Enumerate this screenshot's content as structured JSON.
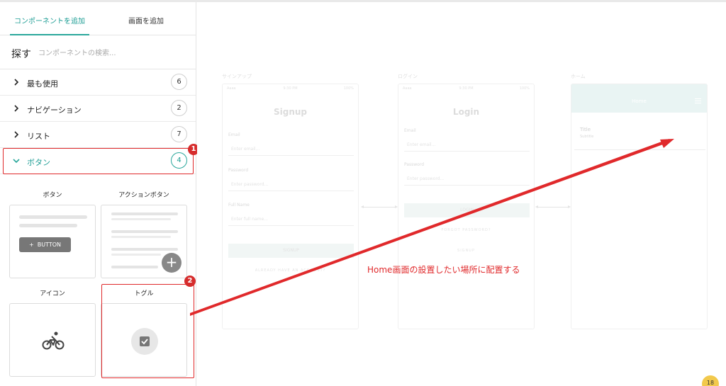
{
  "tabs": [
    {
      "label": "コンポーネントを追加"
    },
    {
      "label": "画面を追加"
    }
  ],
  "search": {
    "label": "探す",
    "placeholder": "コンポーネントの検索..."
  },
  "categories": [
    {
      "label": "最も使用",
      "count": "6"
    },
    {
      "label": "ナビゲーション",
      "count": "2"
    },
    {
      "label": "リスト",
      "count": "7"
    },
    {
      "label": "ボタン",
      "count": "4"
    }
  ],
  "components": [
    {
      "title": "ボタン",
      "demo_label": "BUTTON"
    },
    {
      "title": "アクションボタン"
    },
    {
      "title": "アイコン"
    },
    {
      "title": "トグル"
    }
  ],
  "markers": [
    "1",
    "2"
  ],
  "canvas": {
    "screens": [
      {
        "top_label": "サインアップ",
        "status": {
          "left": "Aaaa",
          "time": "9:30 PM",
          "battery": "100%"
        },
        "title": "Signup",
        "fields": [
          {
            "label": "Email",
            "placeholder": "Enter email..."
          },
          {
            "label": "Password",
            "placeholder": "Enter password..."
          },
          {
            "label": "Full Name",
            "placeholder": "Enter full name..."
          }
        ],
        "button": "SIGNUP",
        "link": "ALREADY HAVE AN ACCOUNT?"
      },
      {
        "top_label": "ログイン",
        "status": {
          "left": "Aaaa",
          "time": "9:30 PM",
          "battery": "100%"
        },
        "title": "Login",
        "fields": [
          {
            "label": "Email",
            "placeholder": "Enter email..."
          },
          {
            "label": "Password",
            "placeholder": "Enter password..."
          }
        ],
        "button": "LOGIN",
        "link": "FORGOT PASSWORD?",
        "link2": "SIGNUP"
      },
      {
        "top_label": "ホーム",
        "header": "Home",
        "list_title": "Title",
        "list_subtitle": "Subtitle"
      }
    ]
  },
  "annotation": "Home画面の設置したい場所に配置する",
  "help_count": "18",
  "colors": {
    "accent": "#2aa79b",
    "annotation_red": "#e0292b"
  }
}
